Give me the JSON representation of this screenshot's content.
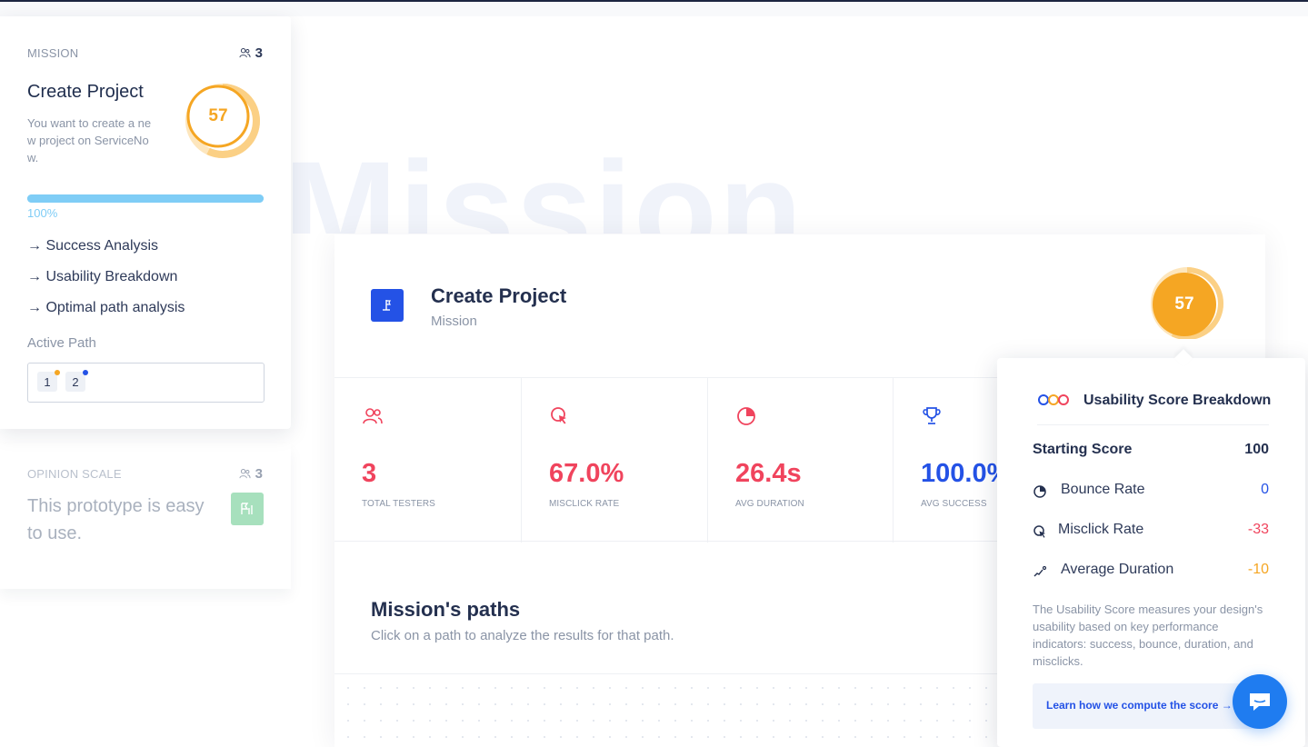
{
  "sidebar": {
    "mission_card": {
      "section_label": "MISSION",
      "tester_count": "3",
      "title": "Create Project",
      "description": "You want to create a new project on ServiceNow.",
      "score": "57",
      "score_ring_fraction": 0.57,
      "progress_percent": 100,
      "progress_label": "100%",
      "links": [
        "→ Success Analysis",
        "→ Usability Breakdown",
        "→ Optimal path analysis"
      ],
      "active_path_label": "Active Path",
      "path_chips": [
        {
          "label": "1",
          "dot_color": "#f5a623"
        },
        {
          "label": "2",
          "dot_color": "#2452e6"
        }
      ]
    },
    "opinion_card": {
      "section_label": "OPINION SCALE",
      "tester_count": "3",
      "text": "This prototype is easy to use."
    }
  },
  "main": {
    "watermark": "Mission",
    "header": {
      "title": "Create Project",
      "subtitle": "Mission",
      "score": "57"
    },
    "stats": [
      {
        "value": "3",
        "label": "TOTAL TESTERS",
        "icon": "users-icon",
        "color": "#f0445d"
      },
      {
        "value": "67.0%",
        "label": "MISCLICK RATE",
        "icon": "misclick-icon",
        "color": "#f0445d"
      },
      {
        "value": "26.4s",
        "label": "AVG DURATION",
        "icon": "pie-clock-icon",
        "color": "#f0445d"
      },
      {
        "value": "100.0%",
        "label": "AVG SUCCESS",
        "icon": "trophy-icon",
        "color": "#2452e6"
      }
    ],
    "paths": {
      "title": "Mission's paths",
      "subtitle": "Click on a path to analyze the results for that path."
    }
  },
  "popover": {
    "title": "Usability Score Breakdown",
    "starting_score_label": "Starting Score",
    "starting_score_value": "100",
    "rows": [
      {
        "label": "Bounce Rate",
        "value": "0",
        "color": "#2452e6",
        "icon": "pie-icon"
      },
      {
        "label": "Misclick Rate",
        "value": "-33",
        "color": "#f0445d",
        "icon": "cursor-icon"
      },
      {
        "label": "Average Duration",
        "value": "-10",
        "color": "#f5a623",
        "icon": "duration-icon"
      }
    ],
    "description": "The Usability Score measures your design's usability based on key performance indicators: success, bounce, duration, and misclicks.",
    "link_label": "Learn how we compute the score →"
  },
  "colors": {
    "score_orange": "#f5a623",
    "accent_blue": "#2452e6",
    "danger_red": "#f0445d",
    "progress_blue": "#7fcdf6"
  }
}
